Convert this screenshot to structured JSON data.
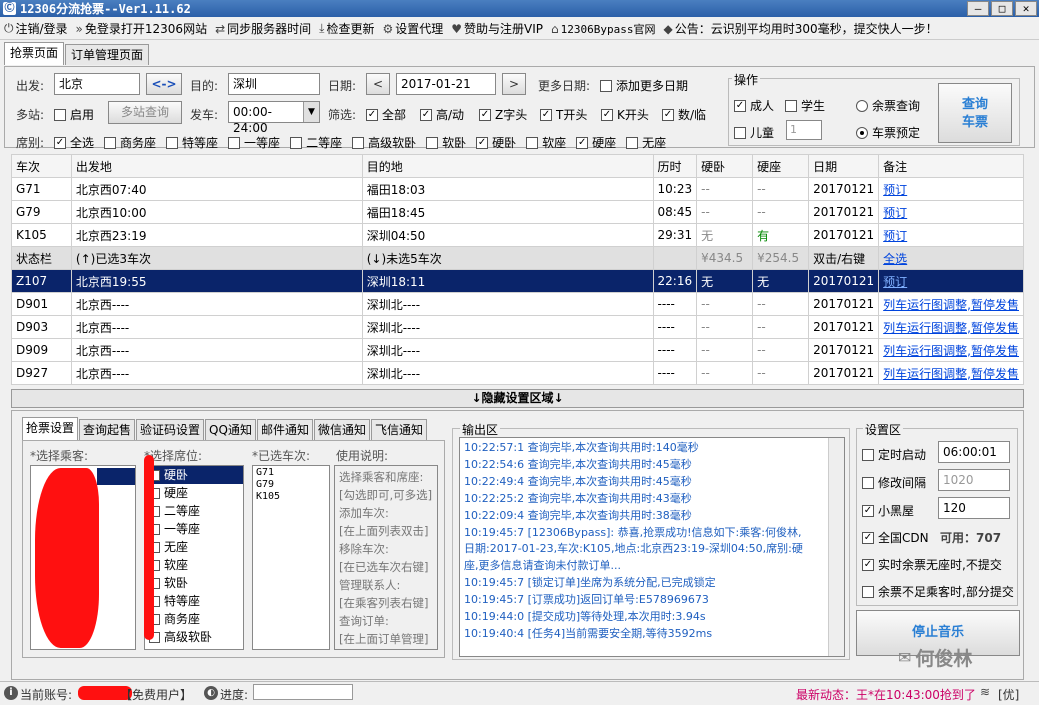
{
  "title": "12306分流抢票--Ver1.11.62",
  "menu": [
    {
      "icon": "power-icon",
      "label": "注销/登录"
    },
    {
      "icon": "forward-icon",
      "label": "免登录打开12306网站"
    },
    {
      "icon": "sync-icon",
      "label": "同步服务器时间"
    },
    {
      "icon": "download-icon",
      "label": "检查更新"
    },
    {
      "icon": "gear-icon",
      "label": "设置代理"
    },
    {
      "icon": "heart-icon",
      "label": "赞助与注册VIP"
    },
    {
      "icon": "home-icon",
      "label": "12306Bypass官网"
    },
    {
      "icon": "tag-icon",
      "label": "公告：云识别平均用时300毫秒，提交快人一步！"
    }
  ],
  "tabs": [
    "抢票页面",
    "订单管理页面"
  ],
  "form": {
    "from_label": "出发:",
    "from_value": "北京",
    "swap_label": "<->",
    "to_label": "目的:",
    "to_value": "深圳",
    "date_label": "日期:",
    "date_value": "2017-01-21",
    "prev": "<",
    "next": ">",
    "more_dates_label": "更多日期:",
    "more_dates_cb": "添加更多日期",
    "multi_label": "多站:",
    "enable_label": "启用",
    "multi_btn": "多站查询",
    "depart_label": "发车:",
    "depart_value": "00:00-24:00",
    "filter_label": "筛选:",
    "filters": [
      "全部",
      "高/动",
      "Z字头",
      "T开头",
      "K开头",
      "数/临"
    ],
    "seat_label": "席别:",
    "seats": [
      {
        "label": "全选",
        "checked": true
      },
      {
        "label": "商务座",
        "checked": false
      },
      {
        "label": "特等座",
        "checked": false
      },
      {
        "label": "一等座",
        "checked": false
      },
      {
        "label": "二等座",
        "checked": false
      },
      {
        "label": "高级软卧",
        "checked": false
      },
      {
        "label": "软卧",
        "checked": false
      },
      {
        "label": "硬卧",
        "checked": true
      },
      {
        "label": "软座",
        "checked": false
      },
      {
        "label": "硬座",
        "checked": true
      },
      {
        "label": "无座",
        "checked": false
      }
    ]
  },
  "ops": {
    "title": "操作",
    "adult": "成人",
    "student": "学生",
    "child": "儿童",
    "child_count": "1",
    "query_remain": "余票查询",
    "book": "车票预定",
    "query_btn_1": "查询",
    "query_btn_2": "车票"
  },
  "table": {
    "headers": [
      "车次",
      "出发地",
      "目的地",
      "历时",
      "硬卧",
      "硬座",
      "日期",
      "备注"
    ],
    "rows": [
      {
        "train": "G71",
        "from": "北京西07:40",
        "to": "福田18:03",
        "dur": "10:23",
        "wo": "--",
        "zuo": "--",
        "date": "20170121",
        "note": "预订",
        "type": "normal"
      },
      {
        "train": "G79",
        "from": "北京西10:00",
        "to": "福田18:45",
        "dur": "08:45",
        "wo": "--",
        "zuo": "--",
        "date": "20170121",
        "note": "预订",
        "type": "normal"
      },
      {
        "train": "K105",
        "from": "北京西23:19",
        "to": "深圳04:50",
        "dur": "29:31",
        "wo": "无",
        "zuo": "有",
        "date": "20170121",
        "note": "预订",
        "type": "normal"
      },
      {
        "train": "状态栏",
        "from": "(↑)已选3车次",
        "to": "(↓)未选5车次",
        "dur": "",
        "wo": "¥434.5",
        "zuo": "¥254.5",
        "date": "双击/右键",
        "note": "全选",
        "type": "status"
      },
      {
        "train": "Z107",
        "from": "北京西19:55",
        "to": "深圳18:11",
        "dur": "22:16",
        "wo": "无",
        "zuo": "无",
        "date": "20170121",
        "note": "预订",
        "type": "sel"
      },
      {
        "train": "D901",
        "from": "北京西----",
        "to": "深圳北----",
        "dur": "----",
        "wo": "--",
        "zuo": "--",
        "date": "20170121",
        "note": "列车运行图调整,暂停发售",
        "type": "normal"
      },
      {
        "train": "D903",
        "from": "北京西----",
        "to": "深圳北----",
        "dur": "----",
        "wo": "--",
        "zuo": "--",
        "date": "20170121",
        "note": "列车运行图调整,暂停发售",
        "type": "normal"
      },
      {
        "train": "D909",
        "from": "北京西----",
        "to": "深圳北----",
        "dur": "----",
        "wo": "--",
        "zuo": "--",
        "date": "20170121",
        "note": "列车运行图调整,暂停发售",
        "type": "normal"
      },
      {
        "train": "D927",
        "from": "北京西----",
        "to": "深圳北----",
        "dur": "----",
        "wo": "--",
        "zuo": "--",
        "date": "20170121",
        "note": "列车运行图调整,暂停发售",
        "type": "normal"
      }
    ]
  },
  "hide_bar": "↓隐藏设置区域↓",
  "lower_tabs": [
    "抢票设置",
    "查询起售",
    "验证码设置",
    "QQ通知",
    "邮件通知",
    "微信通知",
    "飞信通知"
  ],
  "passenger_title": "*选择乘客:",
  "seat_title": "*选择席位:",
  "seat_list": [
    "硬卧",
    "硬座",
    "二等座",
    "一等座",
    "无座",
    "软座",
    "软卧",
    "特等座",
    "商务座",
    "高级软卧"
  ],
  "selected_title": "*已选车次:",
  "selected_trains": [
    "G71",
    "G79",
    "K105"
  ],
  "usage_title": "使用说明:",
  "usage_lines": [
    "选择乘客和席座:",
    "[勾选即可,可多选]",
    "添加车次:",
    "[在上面列表双击]",
    "移除车次:",
    "[在已选车次右键]",
    "管理联系人:",
    "[在乘客列表右键]",
    "查询订单:",
    "[在上面订单管理]"
  ],
  "output_title": "输出区",
  "output_lines": [
    "10:22:57:1  查询完毕,本次查询共用时:140毫秒",
    "10:22:54:6  查询完毕,本次查询共用时:45毫秒",
    "10:22:49:4  查询完毕,本次查询共用时:45毫秒",
    "10:22:25:2  查询完毕,本次查询共用时:43毫秒",
    "10:22:09:4  查询完毕,本次查询共用时:38毫秒",
    "10:19:45:7  [12306Bypass]: 恭喜,抢票成功!信息如下:乘客:何俊林,",
    "日期:2017-01-23,车次:K105,地点:北京西23:19-深圳04:50,席别:硬",
    "座,更多信息请查询未付款订单...",
    "10:19:45:7  [锁定订单]坐席为系统分配,已完成锁定",
    "10:19:45:7  [订票成功]返回订单号:E578969673",
    "10:19:44:0  [提交成功]等待处理,本次用时:3.94s",
    "10:19:40:4  [任务4]当前需要安全期,等待3592ms"
  ],
  "settings": {
    "title": "设置区",
    "timer_label": "定时启动",
    "timer_value": "06:00:01",
    "interval_label": "修改间隔",
    "interval_value": "1020",
    "blackroom_label": "小黑屋",
    "blackroom_value": "120",
    "cdn_label": "全国CDN",
    "cdn_avail": "可用：707",
    "rt_label": "实时余票无座时,不提交",
    "partial_label": "余票不足乘客时,部分提交",
    "stop_music": "停止音乐"
  },
  "watermark": "何俊林",
  "statusbar": {
    "account_label": "当前账号:",
    "account_type": "【免费用户】",
    "progress_label": "进度:",
    "news": "最新动态：王*在10:43:00抢到了",
    "tail": "[优]"
  },
  "colors": {
    "accent": "#0a246a",
    "link": "#0044dd",
    "output": "#2060c0",
    "status_news": "#cc0066"
  }
}
